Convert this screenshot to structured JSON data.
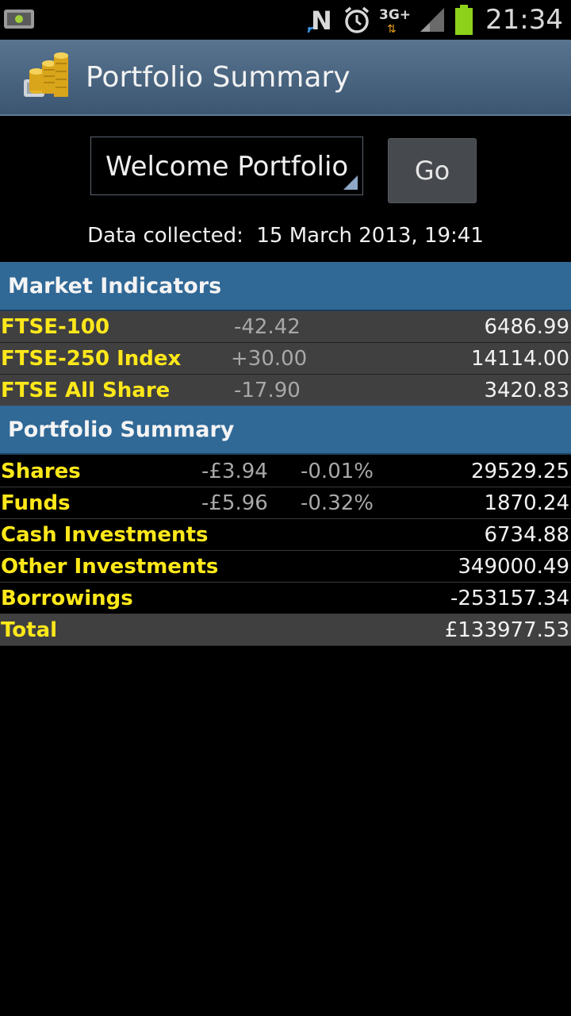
{
  "status_bar": {
    "time": "21:34",
    "network_label": "3G+",
    "icons": [
      "android-debug-icon",
      "nfc-icon",
      "alarm-icon",
      "network-3g-icon",
      "signal-icon",
      "battery-icon"
    ]
  },
  "action_bar": {
    "title": "Portfolio Summary",
    "icon": "gold-coins-icon"
  },
  "portfolio_picker": {
    "selected": "Welcome Portfolio",
    "go_label": "Go"
  },
  "data_collected": "Data collected:  15 March 2013, 19:41",
  "market_indicators": {
    "header": "Market Indicators",
    "rows": [
      {
        "name": "FTSE-100",
        "change": "-42.42",
        "value": "6486.99"
      },
      {
        "name": "FTSE-250 Index",
        "change": "+30.00",
        "value": "14114.00"
      },
      {
        "name": "FTSE All Share",
        "change": "-17.90",
        "value": "3420.83"
      }
    ]
  },
  "portfolio_summary": {
    "header": "Portfolio Summary",
    "rows": [
      {
        "name": "Shares",
        "change": "-£3.94",
        "change_pct": "-0.01%",
        "value": "29529.25"
      },
      {
        "name": "Funds",
        "change": "-£5.96",
        "change_pct": "-0.32%",
        "value": "1870.24"
      },
      {
        "name": "Cash Investments",
        "change": "",
        "change_pct": "",
        "value": "6734.88"
      },
      {
        "name": "Other Investments",
        "change": "",
        "change_pct": "",
        "value": "349000.49"
      },
      {
        "name": "Borrowings",
        "change": "",
        "change_pct": "",
        "value": "-253157.34"
      }
    ],
    "total_label": "Total",
    "total_value": "£133977.53"
  },
  "colors": {
    "label_yellow": "#ffe81a",
    "header_blue": "#306896",
    "row_grey": "#404040",
    "battery_green": "#8ed11b"
  }
}
